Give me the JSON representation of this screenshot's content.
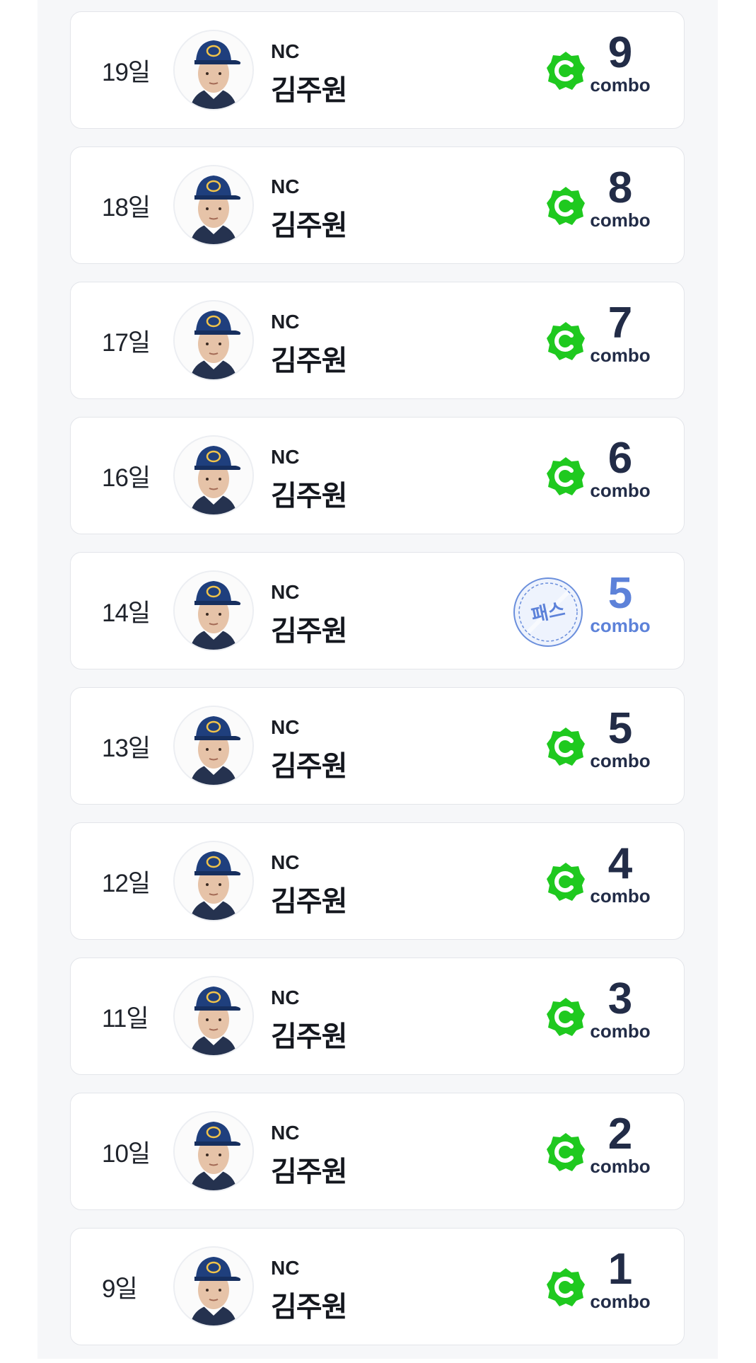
{
  "colors": {
    "combo_text": "#222c47",
    "pass_text": "#5d82d9",
    "badge_green": "#1fc91f",
    "card_border": "#e3e5ea",
    "panel_bg": "#f6f7f9"
  },
  "combo_label": "combo",
  "entries": [
    {
      "day": "19일",
      "team": "NC",
      "player": "김주원",
      "combo": "9",
      "badge": "green-c-badge-icon"
    },
    {
      "day": "18일",
      "team": "NC",
      "player": "김주원",
      "combo": "8",
      "badge": "green-c-badge-icon"
    },
    {
      "day": "17일",
      "team": "NC",
      "player": "김주원",
      "combo": "7",
      "badge": "green-c-badge-icon"
    },
    {
      "day": "16일",
      "team": "NC",
      "player": "김주원",
      "combo": "6",
      "badge": "green-c-badge-icon"
    },
    {
      "day": "14일",
      "team": "NC",
      "player": "김주원",
      "combo": "5",
      "badge": "pass-stamp-icon",
      "pass_label": "패스"
    },
    {
      "day": "13일",
      "team": "NC",
      "player": "김주원",
      "combo": "5",
      "badge": "green-c-badge-icon"
    },
    {
      "day": "12일",
      "team": "NC",
      "player": "김주원",
      "combo": "4",
      "badge": "green-c-badge-icon"
    },
    {
      "day": "11일",
      "team": "NC",
      "player": "김주원",
      "combo": "3",
      "badge": "green-c-badge-icon"
    },
    {
      "day": "10일",
      "team": "NC",
      "player": "김주원",
      "combo": "2",
      "badge": "green-c-badge-icon"
    },
    {
      "day": "9일",
      "team": "NC",
      "player": "김주원",
      "combo": "1",
      "badge": "green-c-badge-icon"
    }
  ]
}
